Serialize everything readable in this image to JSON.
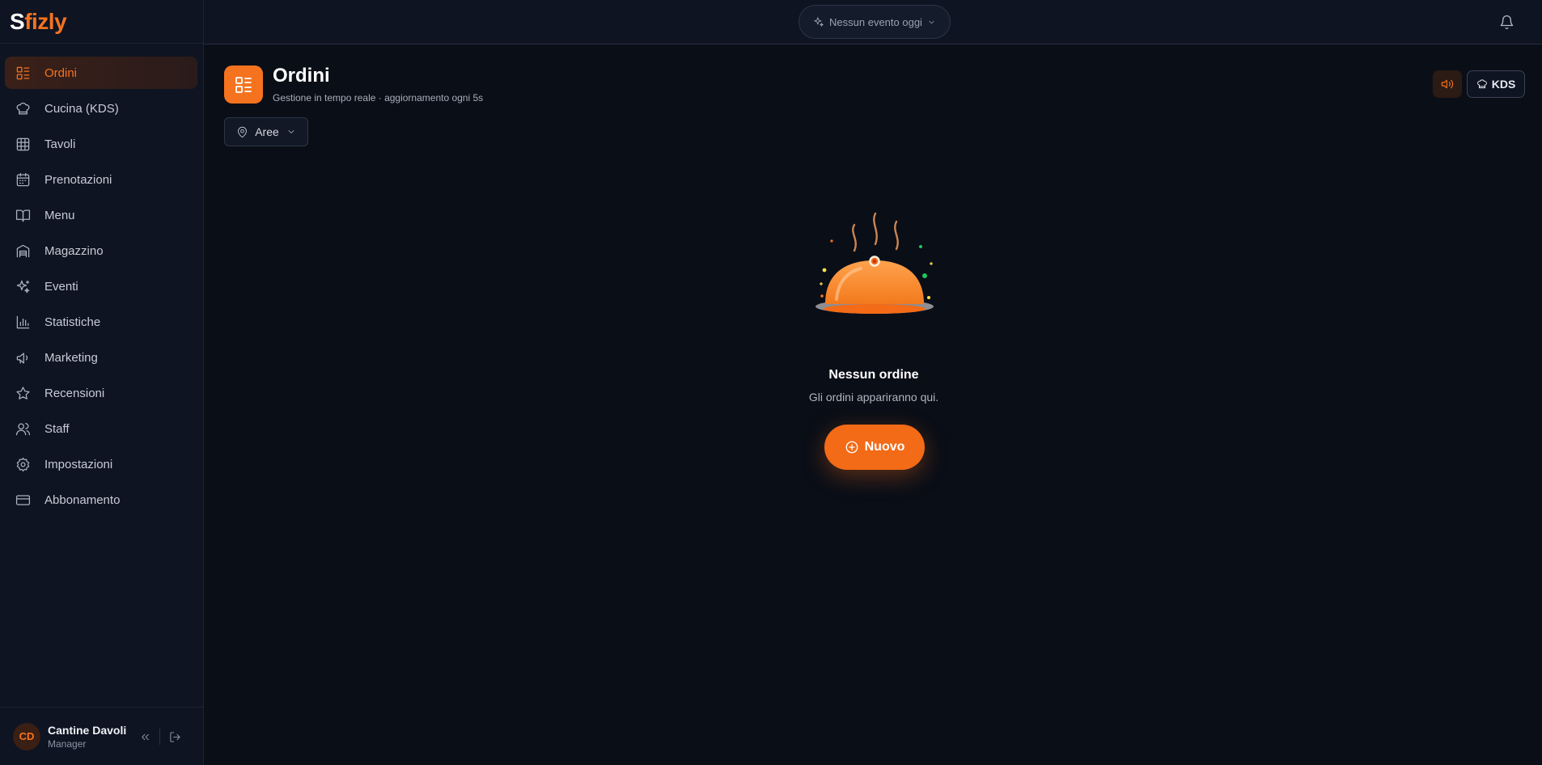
{
  "brand": {
    "logo_first": "S",
    "logo_rest": "fizly",
    "accent": "#f5731f"
  },
  "sidebar": {
    "items": [
      {
        "label": "Ordini",
        "icon": "orders-list-icon",
        "active": true
      },
      {
        "label": "Cucina (KDS)",
        "icon": "chef-hat-icon"
      },
      {
        "label": "Tavoli",
        "icon": "grid-table-icon"
      },
      {
        "label": "Prenotazioni",
        "icon": "calendar-icon"
      },
      {
        "label": "Menu",
        "icon": "book-icon"
      },
      {
        "label": "Magazzino",
        "icon": "warehouse-icon"
      },
      {
        "label": "Eventi",
        "icon": "sparkles-icon"
      },
      {
        "label": "Statistiche",
        "icon": "bar-chart-icon"
      },
      {
        "label": "Marketing",
        "icon": "megaphone-icon"
      },
      {
        "label": "Recensioni",
        "icon": "star-icon"
      },
      {
        "label": "Staff",
        "icon": "users-icon"
      },
      {
        "label": "Impostazioni",
        "icon": "gear-icon"
      },
      {
        "label": "Abbonamento",
        "icon": "credit-card-icon"
      }
    ],
    "user": {
      "initials": "CD",
      "name": "Cantine Davoli",
      "role": "Manager"
    }
  },
  "topbar": {
    "event_label": "Nessun evento oggi"
  },
  "main": {
    "title": "Ordini",
    "subtitle": "Gestione in tempo reale · aggiornamento ogni 5s",
    "areas_label": "Aree",
    "kds_label": "KDS",
    "empty_title": "Nessun ordine",
    "empty_subtitle": "Gli ordini appariranno qui.",
    "new_label": "Nuovo"
  }
}
